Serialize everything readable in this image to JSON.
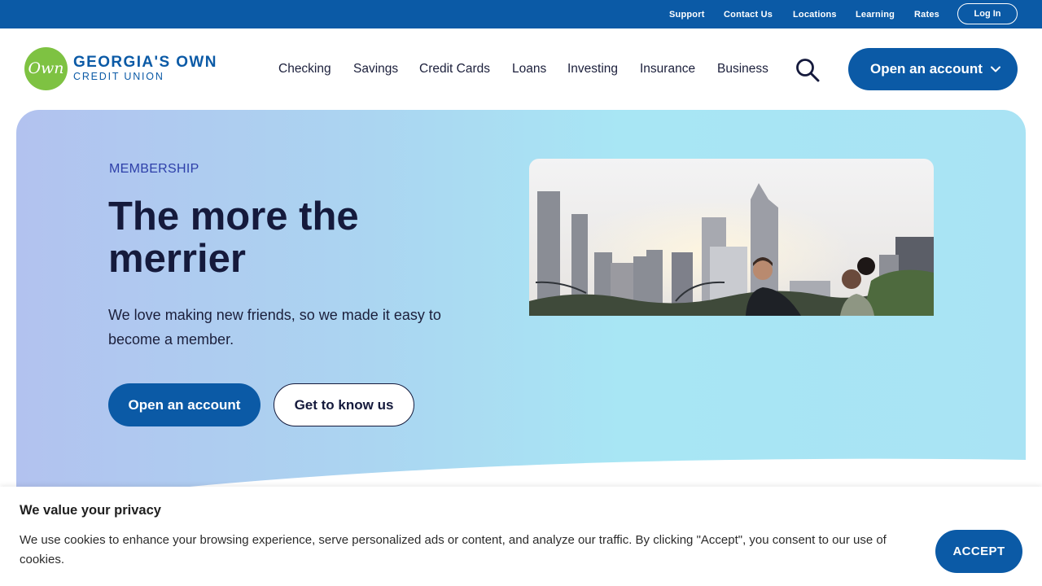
{
  "utility_bar": {
    "links": [
      "Support",
      "Contact Us",
      "Locations",
      "Learning",
      "Rates"
    ],
    "login_label": "Log In"
  },
  "logo": {
    "mark_text": "Own",
    "name": "GEORGIA'S OWN",
    "subtitle": "CREDIT UNION"
  },
  "nav": {
    "items": [
      "Checking",
      "Savings",
      "Credit Cards",
      "Loans",
      "Investing",
      "Insurance",
      "Business"
    ],
    "search_icon": "search-icon",
    "cta_label": "Open an account",
    "cta_icon": "chevron-down-icon"
  },
  "hero": {
    "eyebrow": "MEMBERSHIP",
    "title": "The more the merrier",
    "body": "We love making new friends, so we made it easy to become a member.",
    "primary_button": "Open an account",
    "secondary_button": "Get to know us"
  },
  "cookie_banner": {
    "title": "We value your privacy",
    "text": "We use cookies to enhance your browsing experience, serve personalized ads or content, and analyze our traffic. By clicking \"Accept\", you consent to our use of cookies.",
    "accept_label": "ACCEPT"
  },
  "colors": {
    "brand_blue": "#0b5aa6",
    "logo_green": "#7ec242",
    "heading_navy": "#151a3c",
    "eyebrow_blue": "#2d3fa9"
  }
}
